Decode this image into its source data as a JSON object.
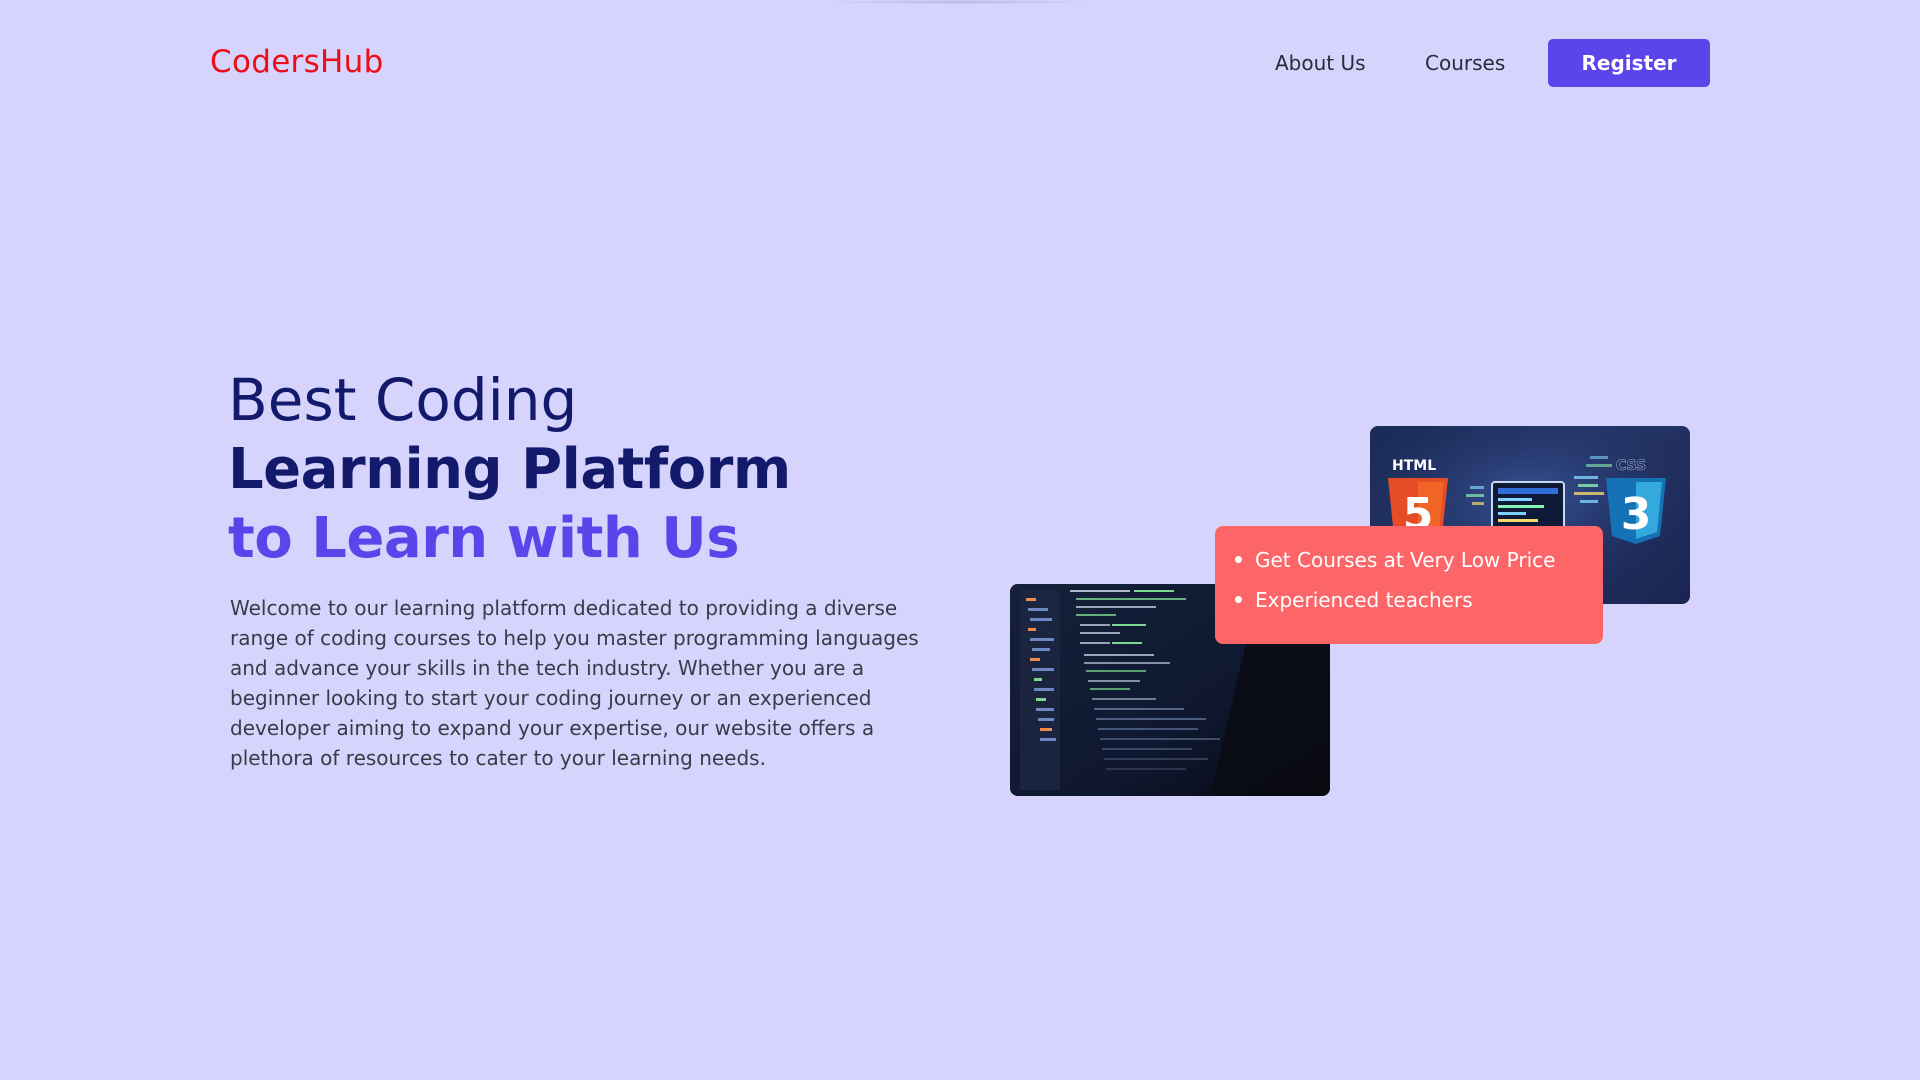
{
  "header": {
    "logo": "CodersHub",
    "nav": {
      "about": "About Us",
      "courses": "Courses"
    },
    "register": "Register"
  },
  "hero": {
    "line1": "Best Coding",
    "line2": "Learning Platform",
    "line3": "to Learn with Us",
    "description": "Welcome to our learning platform dedicated to providing a diverse range of coding courses to help you master programming languages and advance your skills in the tech industry. Whether you are a beginner looking to start your coding journey or an experienced developer aiming to expand your expertise, our website offers a plethora of resources to cater to your learning needs."
  },
  "features": {
    "items": [
      "Get Courses at Very Low Price",
      "Experienced teachers"
    ]
  },
  "images": {
    "html_badge": "HTML",
    "html_number": "5",
    "css_badge": "CSS",
    "css_number": "3"
  },
  "colors": {
    "background": "#d6d4fc",
    "brand_red": "#ee0d17",
    "accent": "#5a44ea",
    "heading": "#13196b",
    "card": "#fd6669"
  }
}
